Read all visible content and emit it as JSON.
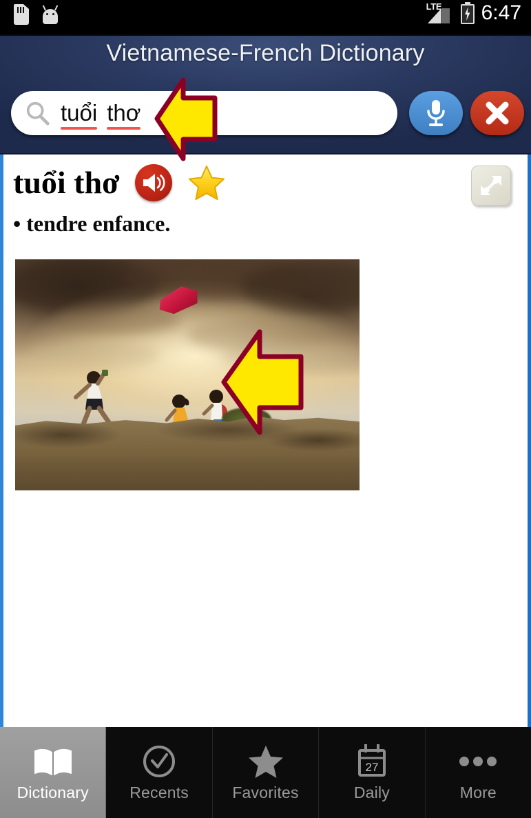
{
  "statusbar": {
    "sd_icon": "sd-card-icon",
    "android_icon": "android-robot-icon",
    "network_label": "LTE",
    "signal_icon": "signal-bars-icon",
    "battery_icon": "battery-charging-icon",
    "time": "6:47"
  },
  "header": {
    "title": "Vietnamese-French Dictionary",
    "search": {
      "icon": "search-icon",
      "value_words": [
        "tuổi",
        "thơ"
      ],
      "value": "tuổi thơ",
      "placeholder": "Search"
    },
    "mic_button": {
      "icon": "microphone-icon",
      "label": ""
    },
    "clear_button": {
      "icon": "close-x-icon",
      "label": ""
    }
  },
  "content": {
    "headword": "tuổi thơ",
    "speak_button_icon": "speaker-volume-icon",
    "favorite_star_icon": "star-filled-icon",
    "expand_button_icon": "expand-diagonal-arrows-icon",
    "definition": "• tendre enfance.",
    "image": {
      "name": "children-flying-kite-photo",
      "alt": "Three children running on a dirt ridge flying a red kite at sunset"
    }
  },
  "annotations": [
    {
      "name": "search-field-arrow",
      "direction": "left",
      "fill": "#FFE800",
      "stroke": "#8C0026"
    },
    {
      "name": "image-arrow",
      "direction": "left",
      "fill": "#FFE800",
      "stroke": "#8C0026"
    }
  ],
  "tabbar": {
    "items": [
      {
        "label": "Dictionary",
        "icon": "open-book-icon",
        "active": true
      },
      {
        "label": "Recents",
        "icon": "check-circle-icon",
        "active": false
      },
      {
        "label": "Favorites",
        "icon": "star-icon",
        "active": false
      },
      {
        "label": "Daily",
        "icon": "calendar-icon",
        "day": "27",
        "active": false
      },
      {
        "label": "More",
        "icon": "ellipsis-icon",
        "active": false
      }
    ]
  },
  "colors": {
    "header_navy": "#1d2a4c",
    "accent_blue": "#2f86d6",
    "mic_blue": "#4a8ed4",
    "clear_red": "#c4381f",
    "speaker_red": "#bb2414",
    "star_gold": "#FFD21E",
    "arrow_yellow": "#FFE800",
    "arrow_outline": "#8C0026",
    "spellcheck_red": "#f4554b",
    "tab_active_gray": "#959595",
    "tab_inactive_text": "#9a9a9a"
  }
}
